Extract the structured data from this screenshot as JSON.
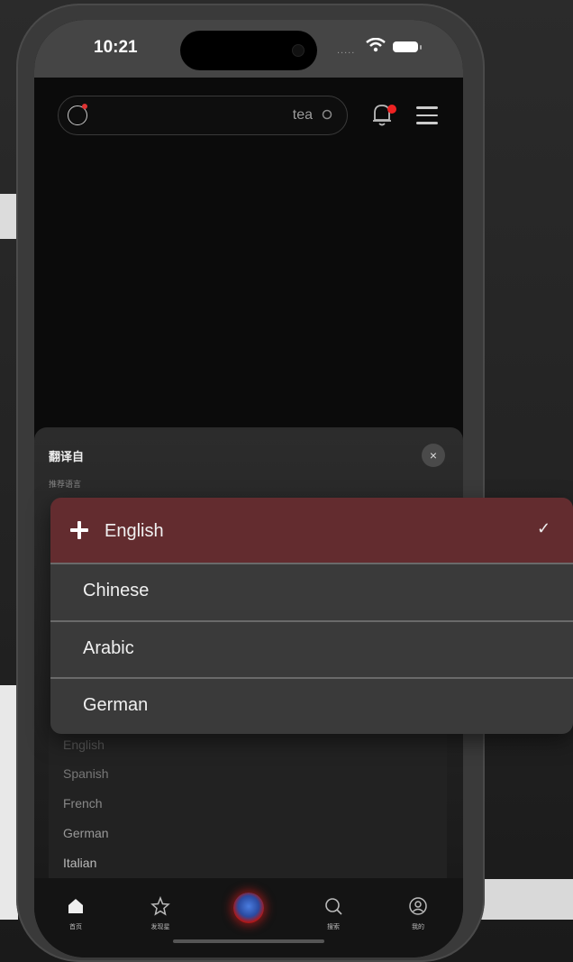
{
  "status_bar": {
    "time": "10:21",
    "signal": "....."
  },
  "header": {
    "search_text": "tea"
  },
  "sheet": {
    "title": "翻译自",
    "subtitle": "推荐语言",
    "close_symbol": "×",
    "languages": [
      "English",
      "Spanish",
      "French",
      "German",
      "Italian"
    ]
  },
  "dropdown": {
    "selected": "English",
    "options": [
      "English",
      "Chinese",
      "Arabic",
      "German"
    ],
    "check_symbol": "✓",
    "selected_color": "#632c2f"
  },
  "bottom_nav": {
    "items": [
      {
        "label": "首页",
        "icon": "home-icon"
      },
      {
        "label": "发现星",
        "icon": "star-icon"
      },
      {
        "label": "",
        "icon": "globe-center-icon"
      },
      {
        "label": "搜索",
        "icon": "search-icon"
      },
      {
        "label": "我的",
        "icon": "profile-icon"
      }
    ]
  }
}
